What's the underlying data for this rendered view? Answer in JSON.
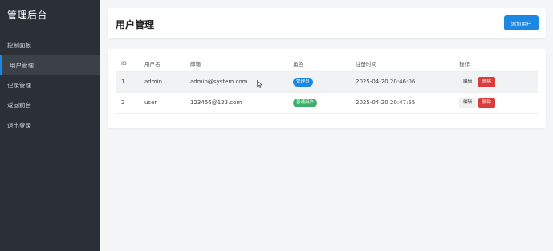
{
  "sidebar": {
    "brand": "管理后台",
    "items": [
      {
        "label": "控制面板"
      },
      {
        "label": "用户管理"
      },
      {
        "label": "记录管理"
      },
      {
        "label": "返回前台"
      },
      {
        "label": "退出登录"
      }
    ]
  },
  "header": {
    "title": "用户管理",
    "add_button": "添加用户"
  },
  "table": {
    "columns": [
      "ID",
      "用户名",
      "邮箱",
      "角色",
      "注册时间",
      "操作"
    ],
    "rows": [
      {
        "id": "1",
        "username": "admin",
        "email": "admin@system.com",
        "role": "管理员",
        "created": "2025-04-20 20:46:06",
        "edit": "编辑",
        "delete": "删除"
      },
      {
        "id": "2",
        "username": "user",
        "email": "123456@123.com",
        "role": "普通用户",
        "created": "2025-04-20 20:47:55",
        "edit": "编辑",
        "delete": "删除"
      }
    ]
  },
  "colors": {
    "sidebar_bg": "#2b3036",
    "accent": "#1d87e4",
    "admin_badge": "#1d87e4",
    "user_badge": "#3bb06a",
    "delete": "#dc3b3b"
  },
  "icons": {
    "cursor": "mouse-pointer-icon"
  }
}
